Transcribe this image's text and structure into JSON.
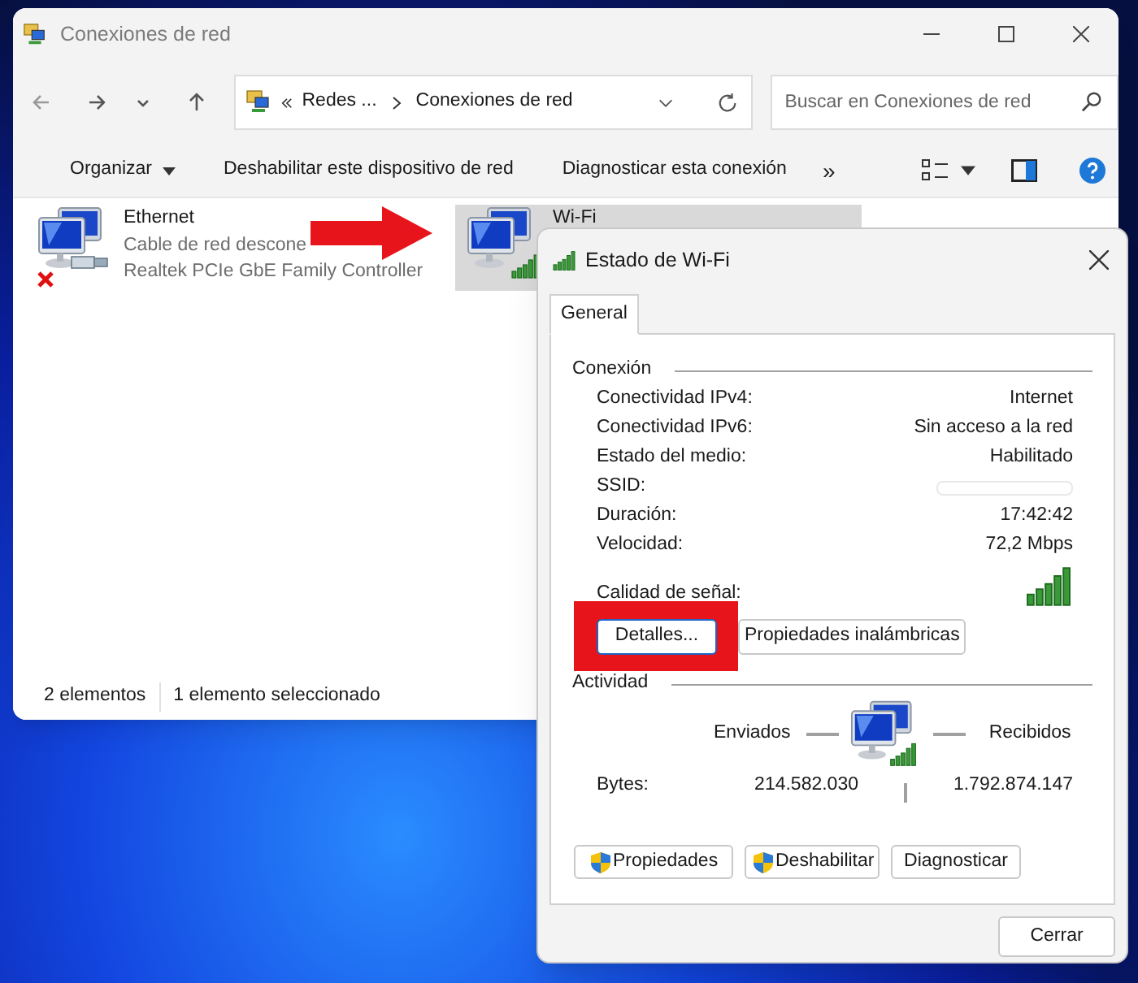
{
  "explorer": {
    "title": "Conexiones de red",
    "address": {
      "breadcrumbs": [
        "Redes ...",
        "Conexiones de red"
      ]
    },
    "search": {
      "placeholder": "Buscar en Conexiones de red"
    },
    "toolbar": [
      {
        "kind": "menu",
        "label": "Organizar"
      },
      {
        "kind": "command",
        "label": "Deshabilitar este dispositivo de red"
      },
      {
        "kind": "command",
        "label": "Diagnosticar esta conexión"
      },
      {
        "kind": "more",
        "label": "»"
      }
    ],
    "items": [
      {
        "kind": "ethernet",
        "name": "Ethernet",
        "connected": false,
        "selected": false,
        "lines": [
          "Cable de red descone",
          "Realtek PCIe GbE Family Controller"
        ]
      },
      {
        "kind": "wifi",
        "name": "Wi-Fi",
        "connected": true,
        "selected": true
      }
    ],
    "status_bar": [
      "2 elementos",
      "1 elemento seleccionado"
    ]
  },
  "dialog": {
    "title": "Estado de Wi-Fi",
    "tabs": [
      {
        "label": "General",
        "selected": true
      }
    ],
    "connection": {
      "heading": "Conexión",
      "rows": [
        {
          "label": "Conectividad IPv4:",
          "value": "Internet"
        },
        {
          "label": "Conectividad IPv6:",
          "value": "Sin acceso a la red"
        },
        {
          "label": "Estado del medio:",
          "value": "Habilitado"
        },
        {
          "label": "SSID:",
          "redacted": true
        },
        {
          "label": "Duración:",
          "value": "17:42:42"
        },
        {
          "label": "Velocidad:",
          "value": "72,2 Mbps"
        }
      ],
      "signal_label": "Calidad de señal:",
      "buttons": [
        {
          "label": "Detalles...",
          "highlighted": true
        },
        {
          "label": "Propiedades inalámbricas",
          "highlighted": false
        }
      ]
    },
    "activity": {
      "heading": "Actividad",
      "sent_label": "Enviados",
      "received_label": "Recibidos",
      "bytes_label": "Bytes:",
      "sent": "214.582.030",
      "received": "1.792.874.147"
    },
    "actions": [
      {
        "label": "Propiedades",
        "shield": true
      },
      {
        "label": "Deshabilitar",
        "shield": true
      },
      {
        "label": "Diagnosticar",
        "shield": false
      }
    ],
    "close_button": "Cerrar"
  }
}
